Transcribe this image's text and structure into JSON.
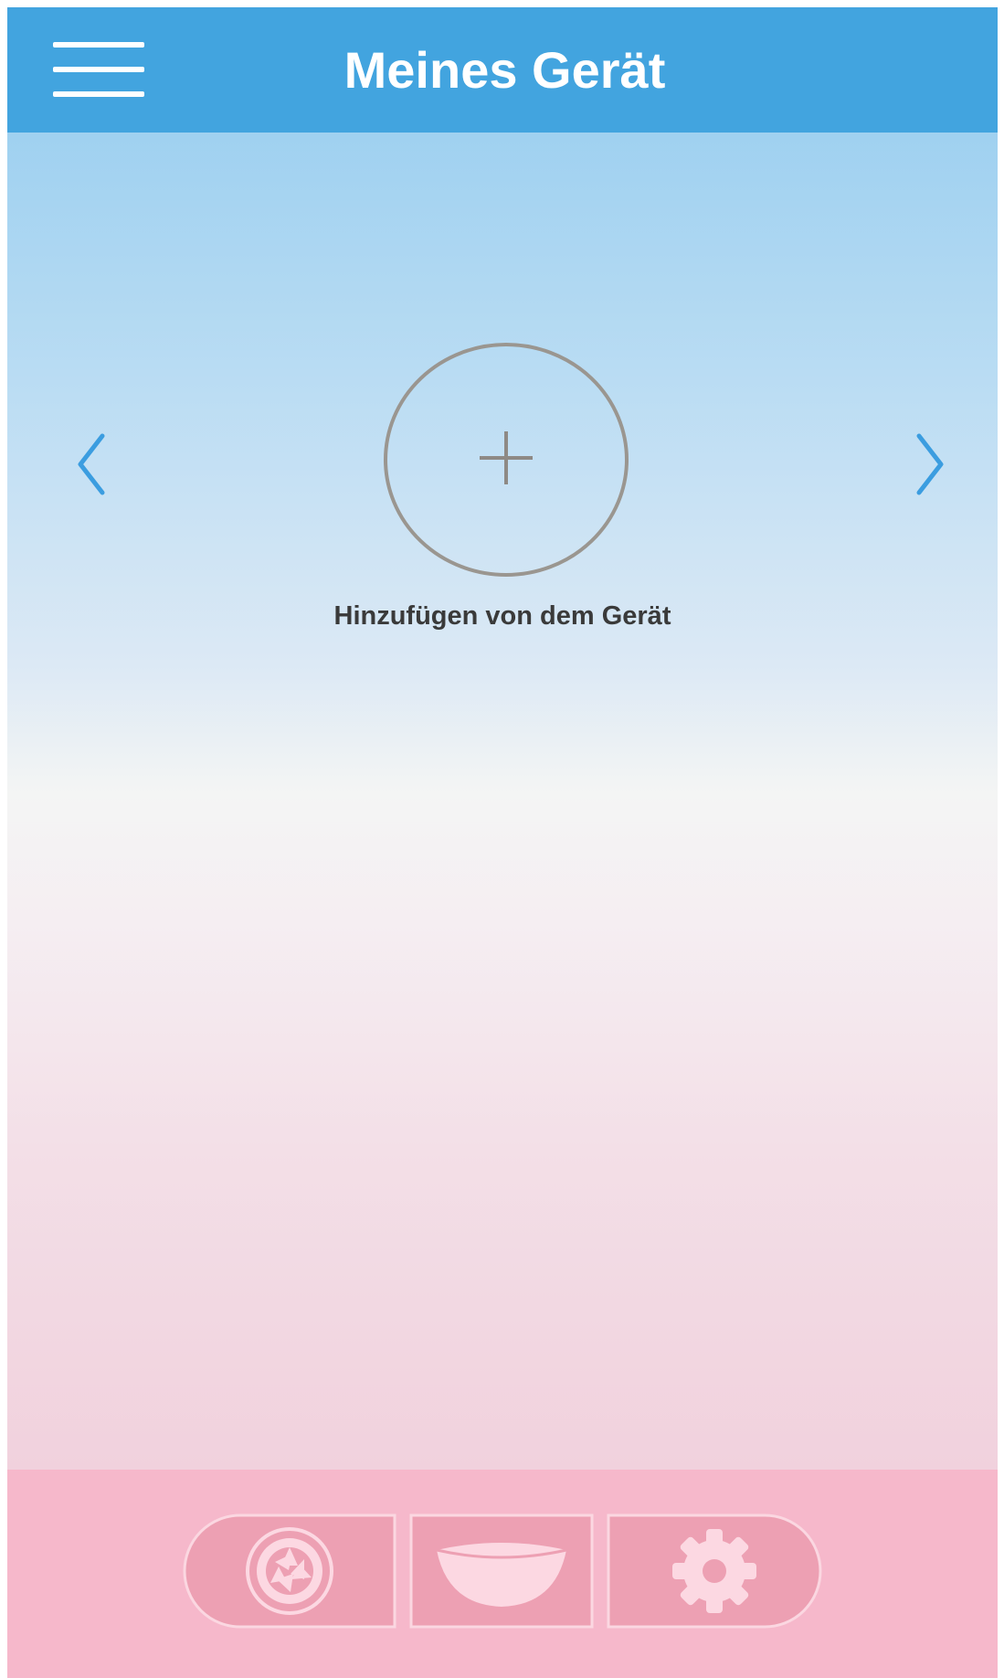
{
  "header": {
    "title": "Meines Gerät",
    "background_color": "#42a4df",
    "menu_icon": "hamburger-menu-icon"
  },
  "carousel": {
    "prev_icon": "chevron-left-icon",
    "next_icon": "chevron-right-icon",
    "arrow_color": "#3b9de0"
  },
  "add_device": {
    "icon": "plus-circle-icon",
    "label": "Hinzufügen von dem Gerät"
  },
  "bottom_bar": {
    "background_color": "#f6b8cb",
    "tab_color": "#eda0b3",
    "tabs": [
      {
        "name": "camera",
        "icon": "camera-aperture-icon"
      },
      {
        "name": "bowl",
        "icon": "bowl-icon"
      },
      {
        "name": "settings",
        "icon": "gear-icon"
      }
    ]
  }
}
